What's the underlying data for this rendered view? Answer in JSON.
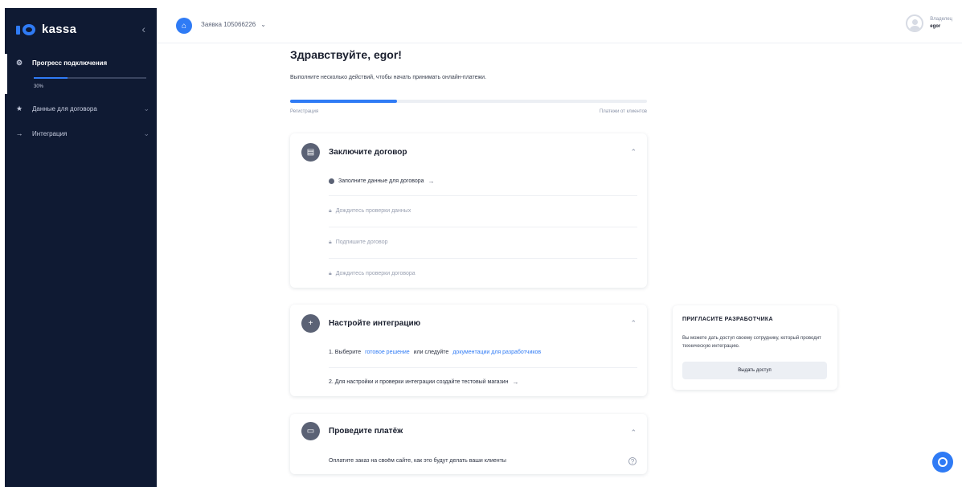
{
  "sidebar": {
    "logo_text": "kassa",
    "collapse_glyph": "‹",
    "progress_label": "Прогресс подключения",
    "progress_fraction": 0.3,
    "progress_percent_text": "30%",
    "items": [
      {
        "label": "Данные для договора",
        "icon": "star-icon"
      },
      {
        "label": "Интеграция",
        "icon": "arrow-right-icon"
      }
    ],
    "accent_color": "#2f7bf5",
    "background_color": "#0f1a33"
  },
  "header": {
    "shop_label": "Заявка 105066226",
    "user_role": "Владелец",
    "user_name": "egor"
  },
  "main": {
    "greeting": "Здравствуйте, egor!",
    "subtitle": "Выполните несколько действий, чтобы начать принимать онлайн-платежи.",
    "progress_fraction": 0.3,
    "progress_start_label": "Регистрация",
    "progress_end_label": "Платежи от клиентов"
  },
  "cards": {
    "contract": {
      "title": "Заключите договор",
      "steps": [
        "Заполните данные для договора",
        "Дождитесь проверки данных",
        "Подпишите договор",
        "Дождитесь проверки договора"
      ]
    },
    "integration": {
      "title": "Настройте интеграцию",
      "step1_prefix": "1. Выберите",
      "step1_link1": "готовое решение",
      "step1_mid": "или следуйте",
      "step1_link2": "документации для разработчиков",
      "step2": "2. Для настройки и проверки интеграции создайте тестовый магазин"
    },
    "payment": {
      "title": "Проведите платёж",
      "step": "Оплатите заказ на своём сайте, как это будут делать ваши клиенты"
    }
  },
  "invite": {
    "title": "ПРИГЛАСИТЕ РАЗРАБОТЧИКА",
    "text": "Вы можете дать доступ своему сотруднику, который проводит техническую интеграцию.",
    "button": "Выдать доступ"
  }
}
